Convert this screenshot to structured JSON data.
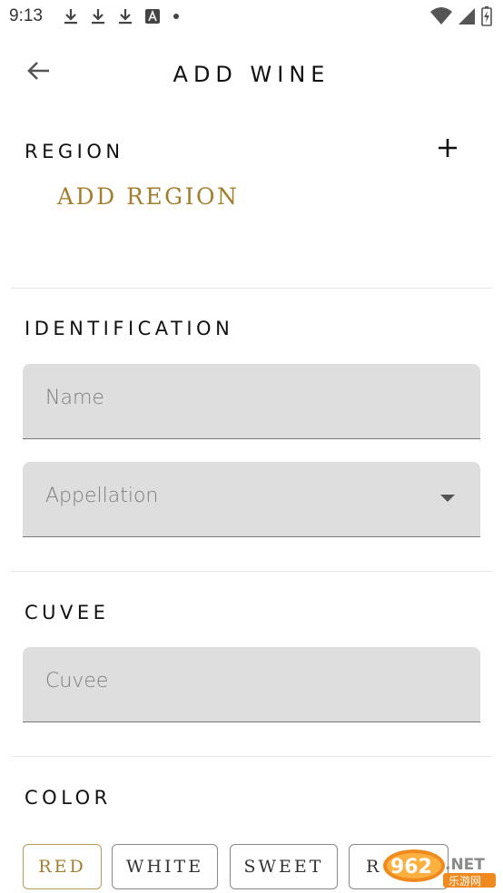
{
  "status_bar": {
    "time": "9:13",
    "left_icons": [
      "download-icon",
      "download-icon",
      "download-icon",
      "font-a-icon",
      "dot-icon"
    ],
    "right_icons": [
      "wifi-icon",
      "signal-icon",
      "battery-icon"
    ]
  },
  "header": {
    "title": "ADD WINE",
    "back_icon": "arrow-left-icon"
  },
  "region": {
    "heading": "REGION",
    "add_icon": "plus-icon",
    "add_label": "ADD REGION"
  },
  "identification": {
    "heading": "IDENTIFICATION",
    "name_placeholder": "Name",
    "appellation_placeholder": "Appellation"
  },
  "cuvee": {
    "heading": "CUVEE",
    "cuvee_placeholder": "Cuvee"
  },
  "color": {
    "heading": "COLOR",
    "options": [
      {
        "label": "RED",
        "selected": true
      },
      {
        "label": "WHITE",
        "selected": false
      },
      {
        "label": "SWEET",
        "selected": false
      },
      {
        "label": "R",
        "selected": false
      }
    ]
  },
  "watermark": {
    "text": "962.NET",
    "subtext": "乐游网"
  },
  "colors": {
    "accent_gold": "#a27f2e",
    "field_bg": "#dedede",
    "divider": "#e6e6e6"
  }
}
